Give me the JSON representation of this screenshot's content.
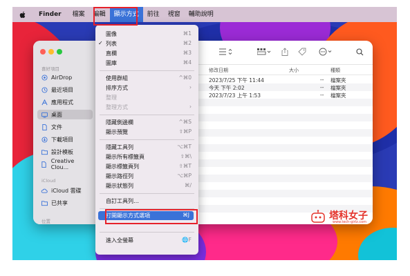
{
  "menubar": {
    "finder": "Finder",
    "items": [
      "檔案",
      "編輯",
      "顯示方式",
      "前往",
      "視窗",
      "輔助說明"
    ]
  },
  "menu": {
    "items": [
      {
        "label": "圖像",
        "shortcut": "⌘1"
      },
      {
        "label": "列表",
        "shortcut": "⌘2",
        "checked": true
      },
      {
        "label": "直欄",
        "shortcut": "⌘3"
      },
      {
        "label": "圖庫",
        "shortcut": "⌘4"
      },
      {
        "label": "使用群組",
        "shortcut": "^⌘0"
      },
      {
        "label": "排序方式",
        "shortcut": "›"
      },
      {
        "label": "整理",
        "shortcut": "",
        "disabled": true
      },
      {
        "label": "整理方式",
        "shortcut": "›",
        "disabled": true
      },
      {
        "label": "隱藏側邊欄",
        "shortcut": "^⌘S"
      },
      {
        "label": "顯示預覽",
        "shortcut": "⇧⌘P"
      },
      {
        "label": "隱藏工具列",
        "shortcut": "⌥⌘T"
      },
      {
        "label": "顯示所有標籤頁",
        "shortcut": "⇧⌘\\"
      },
      {
        "label": "顯示標籤頁列",
        "shortcut": "⇧⌘T"
      },
      {
        "label": "顯示路徑列",
        "shortcut": "⌥⌘P"
      },
      {
        "label": "顯示狀態列",
        "shortcut": "⌘/"
      },
      {
        "label": "自訂工具列…",
        "shortcut": ""
      },
      {
        "label": "打開顯示方式選項",
        "shortcut": "⌘J",
        "selected": true
      },
      {
        "label": "進入全螢幕",
        "shortcut": "🌐F"
      }
    ]
  },
  "sidebar": {
    "favorites_header": "喜好項目",
    "icloud_header": "iCloud",
    "locations_header": "位置",
    "items": [
      {
        "label": "AirDrop",
        "icon": "airdrop-icon"
      },
      {
        "label": "最近項目",
        "icon": "clock-icon"
      },
      {
        "label": "應用程式",
        "icon": "apps-icon"
      },
      {
        "label": "桌面",
        "icon": "desktop-icon",
        "selected": true
      },
      {
        "label": "文件",
        "icon": "document-icon"
      },
      {
        "label": "下載項目",
        "icon": "download-icon"
      },
      {
        "label": "設計模板",
        "icon": "folder-icon"
      },
      {
        "label": "Creative Clou...",
        "icon": "file-icon"
      },
      {
        "label": "iCloud 雲碟",
        "icon": "cloud-icon"
      },
      {
        "label": "已共享",
        "icon": "shared-folder-icon"
      }
    ]
  },
  "columns": {
    "modified": "修改日期",
    "size": "大小",
    "kind": "種類"
  },
  "rows": [
    {
      "modified": "2023/7/25 下午 11:44",
      "size": "--",
      "kind": "檔案夾"
    },
    {
      "modified": "今天 下午 2:02",
      "size": "--",
      "kind": "檔案夾"
    },
    {
      "modified": "2023/7/23 上午 1:53",
      "size": "--",
      "kind": "檔案夾"
    }
  ],
  "watermark": {
    "text": "塔科女子",
    "url": "www.tech-girlz.com"
  },
  "colors": {
    "accent": "#3a72d8",
    "highlight": "#e6202a",
    "watermark": "#e4342c"
  }
}
